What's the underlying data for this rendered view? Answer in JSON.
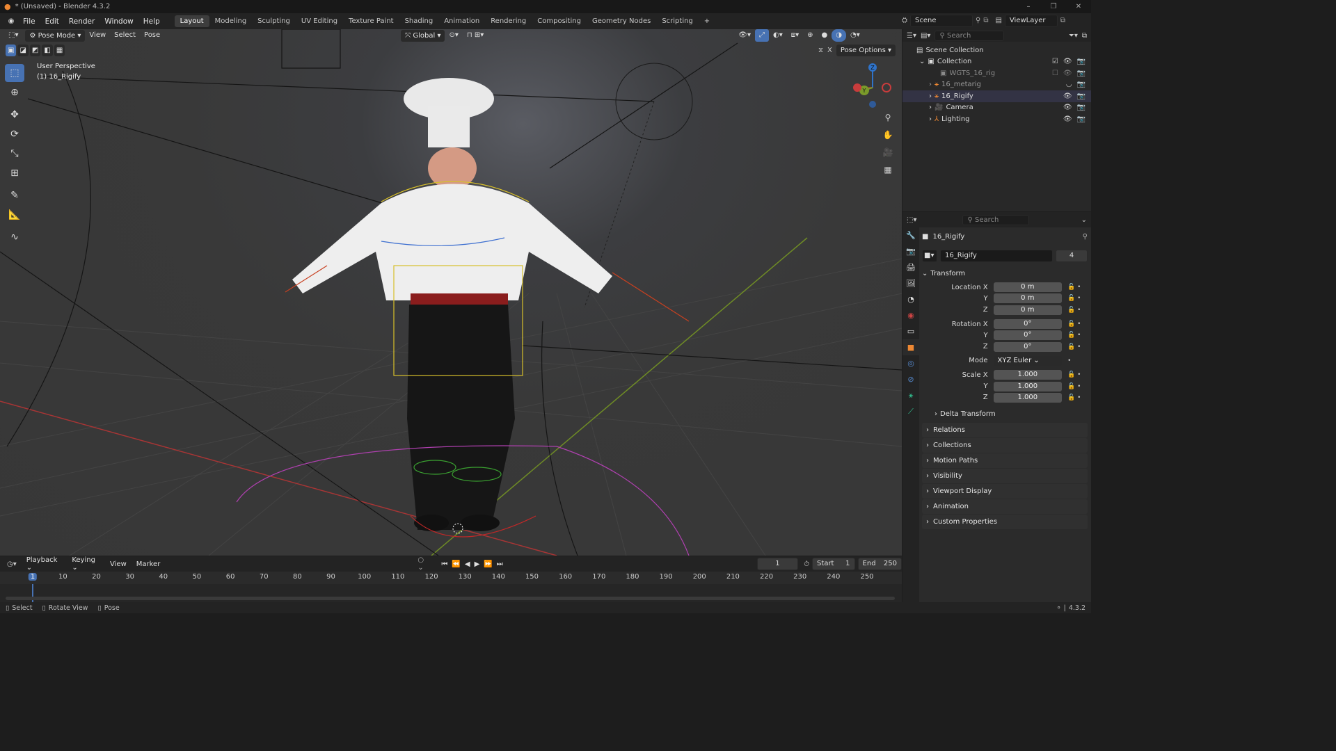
{
  "window": {
    "title": "* (Unsaved) - Blender 4.3.2",
    "version": "4.3.2"
  },
  "menu": {
    "items": [
      "File",
      "Edit",
      "Render",
      "Window",
      "Help"
    ]
  },
  "workspaces": {
    "tabs": [
      "Layout",
      "Modeling",
      "Sculpting",
      "UV Editing",
      "Texture Paint",
      "Shading",
      "Animation",
      "Rendering",
      "Compositing",
      "Geometry Nodes",
      "Scripting"
    ],
    "active": "Layout"
  },
  "scene": {
    "name": "Scene",
    "view_layer": "ViewLayer"
  },
  "viewport_header": {
    "mode": "Pose Mode",
    "menus": [
      "View",
      "Select",
      "Pose"
    ],
    "orientation": "Global",
    "pose_options": "Pose Options"
  },
  "viewport_overlay": {
    "perspective": "User Perspective",
    "active_object": "(1) 16_Rigify"
  },
  "axis_gizmo": {
    "z": "Z",
    "y": "Y",
    "x": "X"
  },
  "outliner": {
    "search_placeholder": "Search",
    "root": "Scene Collection",
    "collection": "Collection",
    "items": [
      {
        "label": "WGTS_16_rig",
        "dim": true
      },
      {
        "label": "16_metarig",
        "dim": true
      },
      {
        "label": "16_Rigify",
        "dim": false
      },
      {
        "label": "Camera",
        "dim": false
      },
      {
        "label": "Lighting",
        "dim": false
      }
    ]
  },
  "properties": {
    "search_placeholder": "Search",
    "object_name": "16_Rigify",
    "datablock_name": "16_Rigify",
    "users": "4",
    "transform_label": "Transform",
    "location": {
      "label": "Location X",
      "x": "0 m",
      "y": "0 m",
      "z": "0 m"
    },
    "rotation": {
      "label": "Rotation X",
      "x": "0°",
      "y": "0°",
      "z": "0°"
    },
    "mode_label": "Mode",
    "mode_value": "XYZ Euler",
    "scale": {
      "label": "Scale X",
      "x": "1.000",
      "y": "1.000",
      "z": "1.000"
    },
    "axis_y": "Y",
    "axis_z": "Z",
    "delta_transform": "Delta Transform",
    "sections": [
      "Relations",
      "Collections",
      "Motion Paths",
      "Visibility",
      "Viewport Display",
      "Animation",
      "Custom Properties"
    ]
  },
  "timeline": {
    "menus": [
      "Playback",
      "Keying",
      "View",
      "Marker"
    ],
    "current_frame": "1",
    "start_label": "Start",
    "start": "1",
    "end_label": "End",
    "end": "250",
    "ruler": [
      "1",
      "10",
      "20",
      "30",
      "40",
      "50",
      "60",
      "70",
      "80",
      "90",
      "100",
      "110",
      "120",
      "130",
      "140",
      "150",
      "160",
      "170",
      "180",
      "190",
      "200",
      "210",
      "220",
      "230",
      "240",
      "250"
    ]
  },
  "statusbar": {
    "items": [
      "Select",
      "Rotate View",
      "Pose"
    ],
    "version": "4.3.2"
  },
  "colors": {
    "accent": "#4772b3",
    "active_tab": "#ee8833",
    "x_axis": "#c83c3c",
    "y_axis": "#7a9a2a",
    "z_axis": "#2f73c9"
  }
}
